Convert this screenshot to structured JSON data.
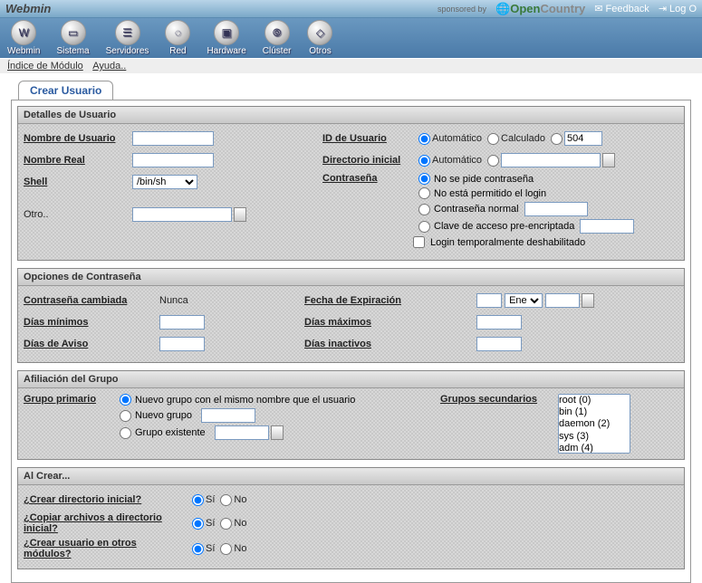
{
  "topbar": {
    "title": "Webmin",
    "sponsor": "sponsored by",
    "oc_open": "Open",
    "oc_country": "Country",
    "feedback": "Feedback",
    "logout": "Log O"
  },
  "iconbar": [
    "Webmin",
    "Sistema",
    "Servidores",
    "Red",
    "Hardware",
    "Clúster",
    "Otros"
  ],
  "breadcrumb": {
    "a": "Índice de Módulo",
    "b": "Ayuda.."
  },
  "tab": "Crear Usuario",
  "sec1": {
    "title": "Detalles de Usuario",
    "l_user": "Nombre de Usuario",
    "l_real": "Nombre Real",
    "l_shell": "Shell",
    "l_otro": "Otro..",
    "shell_val": "/bin/sh",
    "r_uid": "ID de Usuario",
    "r_home": "Directorio inicial",
    "r_pass": "Contraseña",
    "uid_auto": "Automático",
    "uid_calc": "Calculado",
    "uid_val": "504",
    "home_auto": "Automático",
    "p_none": "No se pide contraseña",
    "p_nologin": "No está permitido el login",
    "p_normal": "Contraseña normal",
    "p_pre": "Clave de acceso pre-encriptada",
    "p_temp": "Login temporalmente deshabilitado"
  },
  "sec2": {
    "title": "Opciones de Contraseña",
    "l_changed": "Contraseña cambiada",
    "nunca": "Nunca",
    "l_min": "Días mínimos",
    "l_warn": "Días de Aviso",
    "r_exp": "Fecha de Expiración",
    "month": "Ene",
    "r_max": "Días máximos",
    "r_inact": "Días inactivos"
  },
  "sec3": {
    "title": "Afiliación del Grupo",
    "l_prim": "Grupo primario",
    "g_new": "Nuevo grupo con el mismo nombre que el usuario",
    "g_newg": "Nuevo grupo",
    "g_exist": "Grupo existente",
    "l_sec": "Grupos secundarios",
    "groups": [
      "root (0)",
      "bin (1)",
      "daemon (2)",
      "sys (3)",
      "adm (4)"
    ]
  },
  "sec4": {
    "title": "Al Crear...",
    "q1": "¿Crear directorio inicial?",
    "q2": "¿Copiar archivos a directorio inicial?",
    "q3": "¿Crear usuario en otros módulos?",
    "si": "Sí",
    "no": "No"
  }
}
